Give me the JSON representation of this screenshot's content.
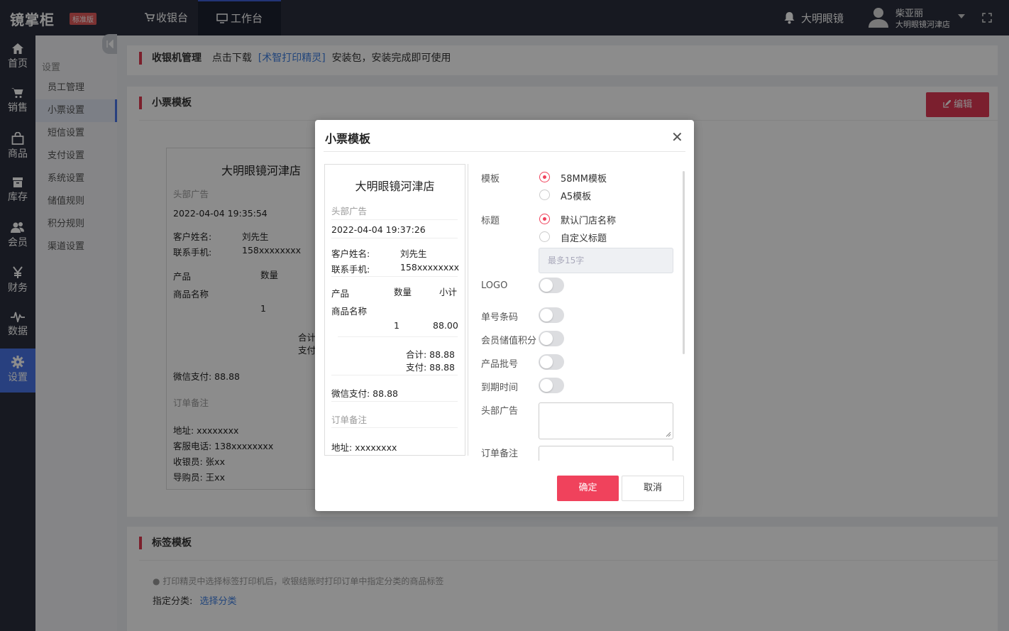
{
  "app": {
    "logo": "镜掌柜",
    "edition": "标准版"
  },
  "topnav": {
    "cashier": "收银台",
    "workbench": "工作台"
  },
  "header": {
    "store": "大明眼镜",
    "user_name": "柴亚丽",
    "user_store": "大明眼镜河津店"
  },
  "leftnav": [
    {
      "label": "首页",
      "icon": "home-icon"
    },
    {
      "label": "销售",
      "icon": "cart-icon"
    },
    {
      "label": "商品",
      "icon": "bag-icon"
    },
    {
      "label": "库存",
      "icon": "box-icon"
    },
    {
      "label": "会员",
      "icon": "members-icon"
    },
    {
      "label": "财务",
      "icon": "yen-icon"
    },
    {
      "label": "数据",
      "icon": "pulse-icon"
    },
    {
      "label": "设置",
      "icon": "gear-icon"
    }
  ],
  "subnav": {
    "title": "设置",
    "items": [
      "员工管理",
      "小票设置",
      "短信设置",
      "支付设置",
      "系统设置",
      "储值规则",
      "积分规则",
      "渠道设置"
    ]
  },
  "cashier_panel": {
    "title": "收银机管理",
    "text1": "点击下载",
    "link": "[术智打印精灵]",
    "text2": "安装包，安装完成即可使用"
  },
  "receipt_panel": {
    "title": "小票模板",
    "edit_label": "编辑"
  },
  "label_panel": {
    "title": "标签模板",
    "tip": "打印精灵中选择标签打印机后，收银结账时打印订单中指定分类的商品标签",
    "category_label": "指定分类:",
    "category_link": "选择分类"
  },
  "bg_receipt": {
    "store": "大明眼镜河津店",
    "header_ad": "头部广告",
    "datetime": "2022-04-04 19:35:54",
    "customer_label": "客户姓名:",
    "customer": "刘先生",
    "phone_label": "联系手机:",
    "phone": "158xxxxxxxx",
    "col_product": "产品",
    "col_qty": "数量",
    "product_name": "商品名称",
    "qty": "1",
    "total_partial": "合计",
    "pay_partial": "支付",
    "wechat": "微信支付: 88.88",
    "order_note": "订单备注",
    "address": "地址: xxxxxxxx",
    "service_phone": "客服电话: 138xxxxxxxx",
    "cashier": "收银员: 张xx",
    "guide": "导购员: 王xx"
  },
  "modal": {
    "title": "小票模板",
    "close": "✕",
    "preview": {
      "store": "大明眼镜河津店",
      "header_ad": "头部广告",
      "datetime": "2022-04-04 19:37:26",
      "customer_label": "客户姓名:",
      "customer": "刘先生",
      "phone_label": "联系手机:",
      "phone": "158xxxxxxxx",
      "col_product": "产品",
      "col_qty": "数量",
      "col_subtotal": "小计",
      "product_name": "商品名称",
      "qty": "1",
      "subtotal": "88.00",
      "total": "合计: 88.88",
      "paid": "支付: 88.88",
      "wechat": "微信支付: 88.88",
      "order_note": "订单备注",
      "address": "地址: xxxxxxxx"
    },
    "form": {
      "template_label": "模板",
      "template_options": [
        "58MM模板",
        "A5模板"
      ],
      "template_selected": 0,
      "title_label": "标题",
      "title_options": [
        "默认门店名称",
        "自定义标题"
      ],
      "title_selected": 0,
      "title_placeholder": "最多15字",
      "logo_label": "LOGO",
      "barcode_label": "单号条码",
      "points_label": "会员储值积分",
      "batch_label": "产品批号",
      "expiry_label": "到期时间",
      "header_ad_label": "头部广告",
      "order_note_label": "订单备注",
      "toggles": {
        "logo": false,
        "barcode": false,
        "points": false,
        "batch": false,
        "expiry": false
      }
    },
    "ok_label": "确定",
    "cancel_label": "取消"
  },
  "colors": {
    "accent": "#f0425c",
    "sidebar": "#2b2f3d",
    "active_nav": "#4a76e8",
    "link": "#3e7fe0"
  }
}
